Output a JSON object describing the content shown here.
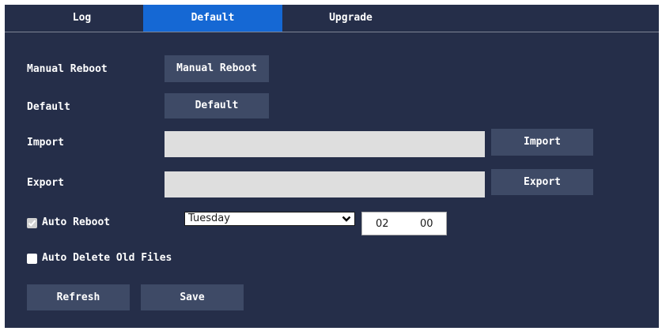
{
  "tabs": [
    {
      "label": "Log",
      "active": false
    },
    {
      "label": "Default",
      "active": true
    },
    {
      "label": "Upgrade",
      "active": false
    }
  ],
  "manual_reboot": {
    "label": "Manual Reboot",
    "button": "Manual Reboot"
  },
  "default": {
    "label": "Default",
    "button": "Default"
  },
  "import": {
    "label": "Import",
    "value": "",
    "button": "Import"
  },
  "export": {
    "label": "Export",
    "value": "",
    "button": "Export"
  },
  "auto_reboot": {
    "label": "Auto Reboot",
    "checked": true,
    "day": "Tuesday",
    "hour": "02",
    "minute": "00"
  },
  "auto_delete": {
    "label": "Auto Delete Old Files",
    "checked": false
  },
  "footer": {
    "refresh": "Refresh",
    "save": "Save"
  },
  "colors": {
    "background": "#252e49",
    "active_tab": "#1568d4",
    "button": "#3e4a66",
    "field": "#dedede"
  }
}
